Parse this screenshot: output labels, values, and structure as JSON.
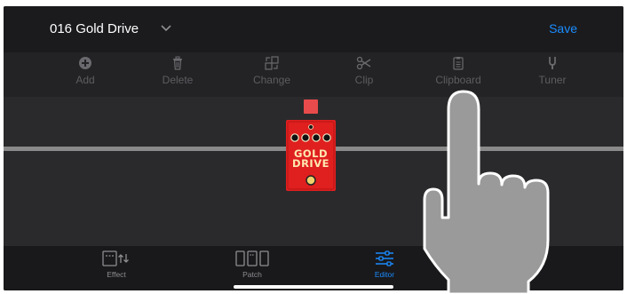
{
  "header": {
    "patch_name": "016 Gold Drive",
    "save_label": "Save"
  },
  "toolbar": {
    "items": [
      {
        "label": "Add",
        "icon": "plus-circle-icon"
      },
      {
        "label": "Delete",
        "icon": "trash-icon"
      },
      {
        "label": "Change",
        "icon": "swap-icon"
      },
      {
        "label": "Clip",
        "icon": "scissors-icon"
      },
      {
        "label": "Clipboard",
        "icon": "clipboard-icon"
      },
      {
        "label": "Tuner",
        "icon": "tuning-fork-icon"
      }
    ]
  },
  "pedal": {
    "name": "GOLD\nDRIVE",
    "color": "#e01f1f"
  },
  "tabs": [
    {
      "label": "Effect",
      "icon": "effect-icon",
      "active": false
    },
    {
      "label": "Patch",
      "icon": "patch-icon",
      "active": false
    },
    {
      "label": "Editor",
      "icon": "sliders-icon",
      "active": true
    }
  ],
  "colors": {
    "accent": "#1a8cff",
    "selector": "#e84b4b",
    "signal_line": "#8a8a8a"
  }
}
